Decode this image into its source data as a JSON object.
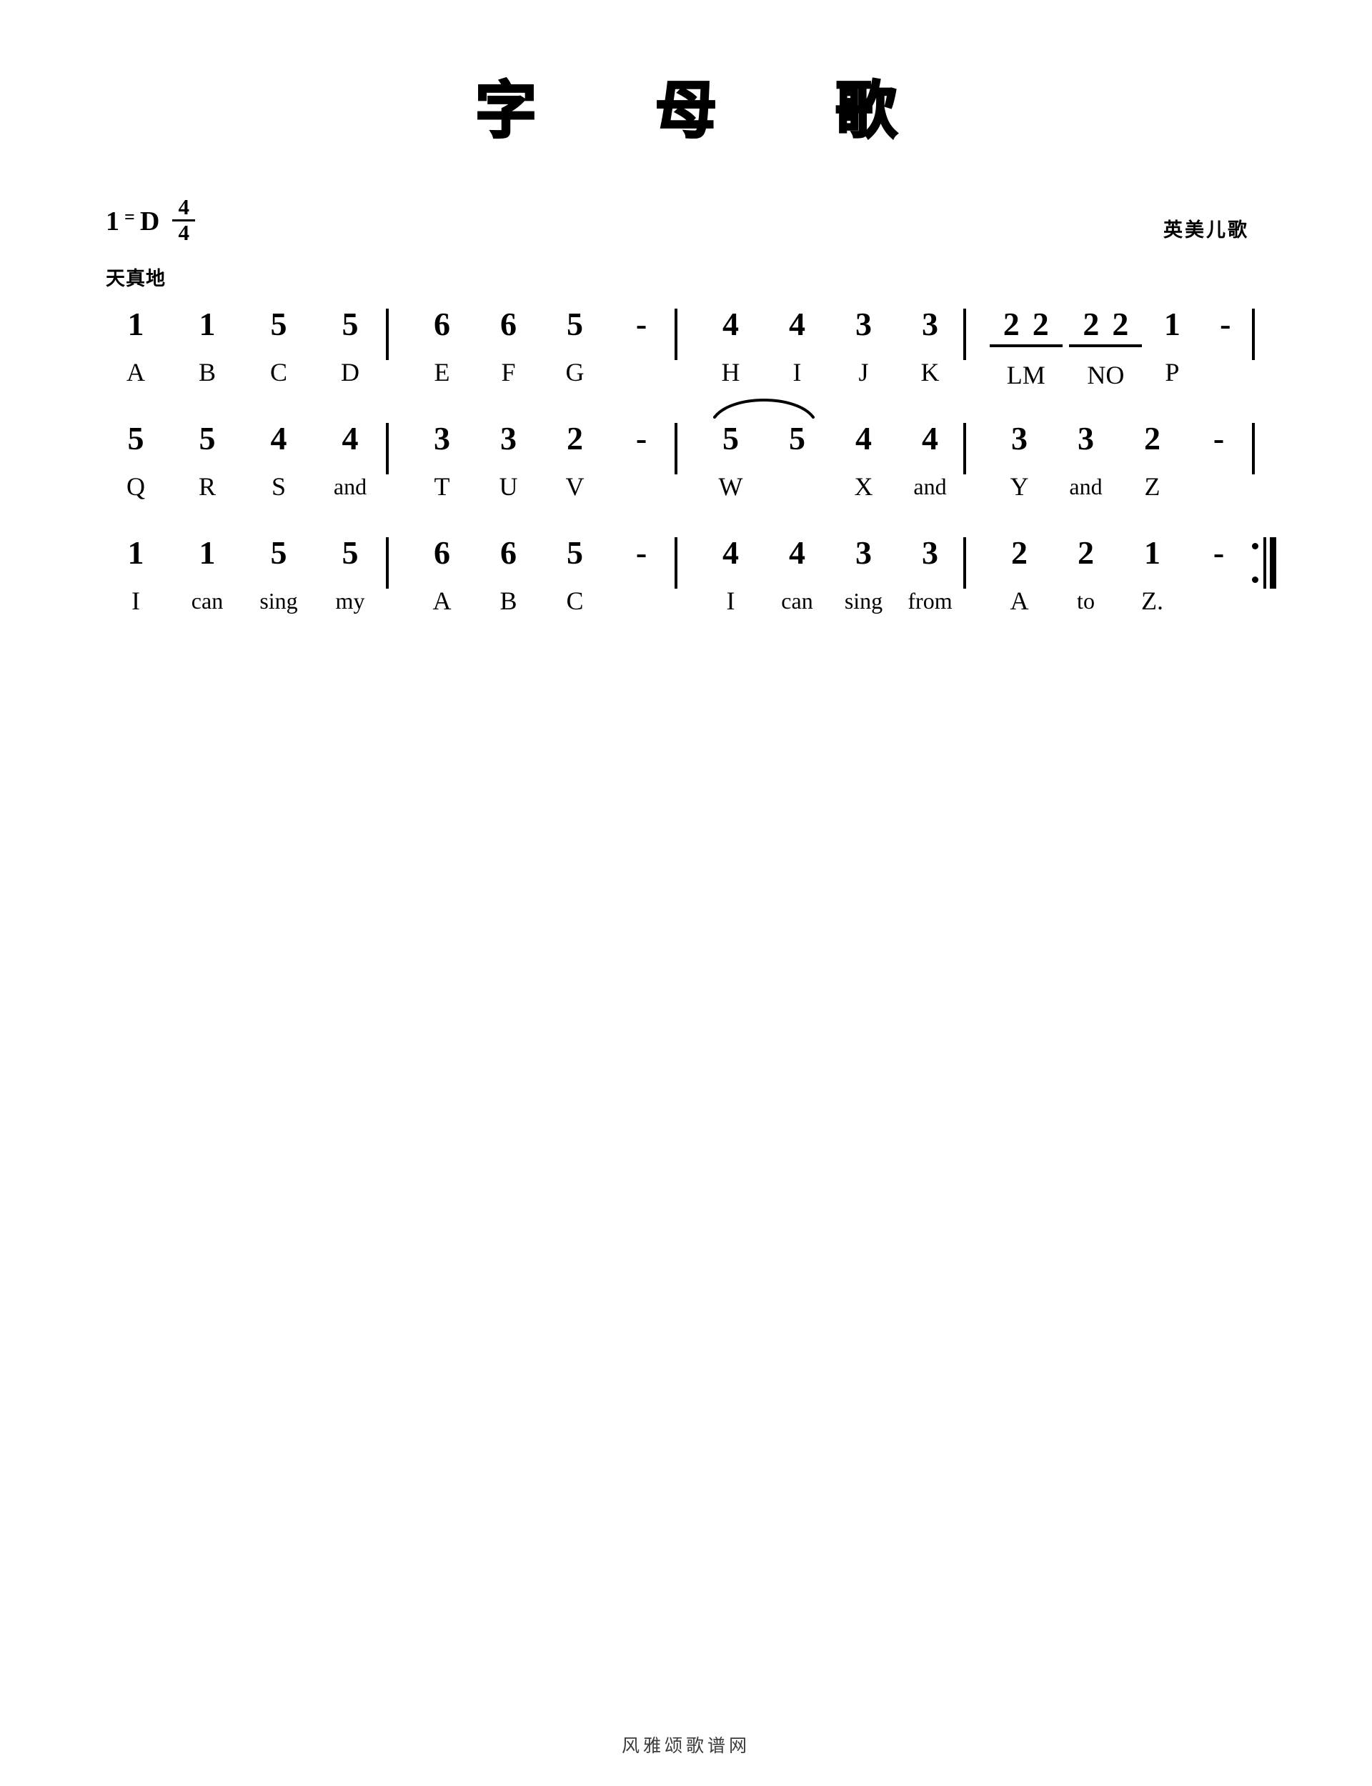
{
  "title": "字　母　歌",
  "key_signature": {
    "do_symbol": "1",
    "equals": "=",
    "key": "D",
    "time_numerator": "4",
    "time_denominator": "4"
  },
  "tempo_mark": "天真地",
  "credit": "英美儿歌",
  "footer": "风雅颂歌谱网",
  "chart_data": {
    "type": "table",
    "title": "字　母　歌",
    "notation": "jianpu",
    "key": "1 = D",
    "time_signature": "4/4",
    "expression": "天真地",
    "source": "英美儿歌",
    "systems": [
      {
        "index": 1,
        "measures": [
          {
            "notes": [
              "1",
              "1",
              "5",
              "5"
            ],
            "lyrics": [
              "A",
              "B",
              "C",
              "D"
            ]
          },
          {
            "notes": [
              "6",
              "6",
              "5",
              "-"
            ],
            "lyrics": [
              "E",
              "F",
              "G",
              ""
            ]
          },
          {
            "notes": [
              "4",
              "4",
              "3",
              "3"
            ],
            "lyrics": [
              "H",
              "I",
              "J",
              "K"
            ]
          },
          {
            "notes": [
              "2 2",
              "2 2",
              "1",
              "-"
            ],
            "lyrics": [
              "LM",
              "NO",
              "P",
              ""
            ],
            "beamed": [
              0,
              1
            ]
          }
        ]
      },
      {
        "index": 2,
        "measures": [
          {
            "notes": [
              "5",
              "5",
              "4",
              "4"
            ],
            "lyrics": [
              "Q",
              "R",
              "S",
              "and"
            ]
          },
          {
            "notes": [
              "3",
              "3",
              "2",
              "-"
            ],
            "lyrics": [
              "T",
              "U",
              "V",
              ""
            ]
          },
          {
            "notes": [
              "5",
              "5",
              "4",
              "4"
            ],
            "lyrics": [
              "W",
              "",
              "X",
              "and"
            ],
            "slur": [
              0,
              1
            ]
          },
          {
            "notes": [
              "3",
              "3",
              "2",
              "-"
            ],
            "lyrics": [
              "Y",
              "and",
              "Z",
              ""
            ]
          }
        ]
      },
      {
        "index": 3,
        "measures": [
          {
            "notes": [
              "1",
              "1",
              "5",
              "5"
            ],
            "lyrics": [
              "I",
              "can",
              "sing",
              "my"
            ]
          },
          {
            "notes": [
              "6",
              "6",
              "5",
              "-"
            ],
            "lyrics": [
              "A",
              "B",
              "C",
              ""
            ]
          },
          {
            "notes": [
              "4",
              "4",
              "3",
              "3"
            ],
            "lyrics": [
              "I",
              "can",
              "sing",
              "from"
            ]
          },
          {
            "notes": [
              "2",
              "2",
              "1",
              "-"
            ],
            "lyrics": [
              "A",
              "to",
              "Z.",
              ""
            ],
            "end_repeat": true
          }
        ]
      }
    ]
  },
  "systems": [
    {
      "m1": {
        "notes": [
          "1",
          "1",
          "5",
          "5"
        ],
        "lyrics": [
          "A",
          "B",
          "C",
          "D"
        ]
      },
      "m2": {
        "notes": [
          "6",
          "6",
          "5",
          "-"
        ],
        "lyrics": [
          "E",
          "F",
          "G",
          ""
        ]
      },
      "m3": {
        "notes": [
          "4",
          "4",
          "3",
          "3"
        ],
        "lyrics": [
          "H",
          "I",
          "J",
          "K"
        ]
      },
      "m4": {
        "notes": [
          "2",
          "2",
          "2",
          "2",
          "1",
          "-"
        ],
        "lyrics": [
          "LM",
          "NO",
          "P",
          ""
        ]
      }
    },
    {
      "m1": {
        "notes": [
          "5",
          "5",
          "4",
          "4"
        ],
        "lyrics": [
          "Q",
          "R",
          "S",
          "and"
        ]
      },
      "m2": {
        "notes": [
          "3",
          "3",
          "2",
          "-"
        ],
        "lyrics": [
          "T",
          "U",
          "V",
          ""
        ]
      },
      "m3": {
        "notes": [
          "5",
          "5",
          "4",
          "4"
        ],
        "lyrics": [
          "W",
          "",
          "X",
          "and"
        ]
      },
      "m4": {
        "notes": [
          "3",
          "3",
          "2",
          "-"
        ],
        "lyrics": [
          "Y",
          "and",
          "Z",
          ""
        ]
      }
    },
    {
      "m1": {
        "notes": [
          "1",
          "1",
          "5",
          "5"
        ],
        "lyrics": [
          "I",
          "can",
          "sing",
          "my"
        ]
      },
      "m2": {
        "notes": [
          "6",
          "6",
          "5",
          "-"
        ],
        "lyrics": [
          "A",
          "B",
          "C",
          ""
        ]
      },
      "m3": {
        "notes": [
          "4",
          "4",
          "3",
          "3"
        ],
        "lyrics": [
          "I",
          "can",
          "sing",
          "from"
        ]
      },
      "m4": {
        "notes": [
          "2",
          "2",
          "1",
          "-"
        ],
        "lyrics": [
          "A",
          "to",
          "Z.",
          ""
        ]
      }
    }
  ]
}
